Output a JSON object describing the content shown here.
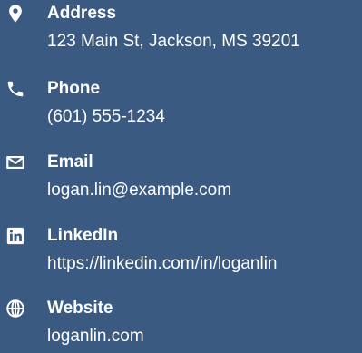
{
  "contact": {
    "items": [
      {
        "icon": "location-pin-icon",
        "label": "Address",
        "value": "123 Main St, Jackson, MS 39201"
      },
      {
        "icon": "phone-icon",
        "label": "Phone",
        "value": "(601) 555-1234"
      },
      {
        "icon": "envelope-icon",
        "label": "Email",
        "value": "logan.lin@example.com"
      },
      {
        "icon": "linkedin-icon",
        "label": "LinkedIn",
        "value": "https://linkedin.com/in/loganlin"
      },
      {
        "icon": "globe-icon",
        "label": "Website",
        "value": "loganlin.com"
      }
    ]
  },
  "colors": {
    "background": "#3a5a82",
    "text": "#ffffff"
  }
}
